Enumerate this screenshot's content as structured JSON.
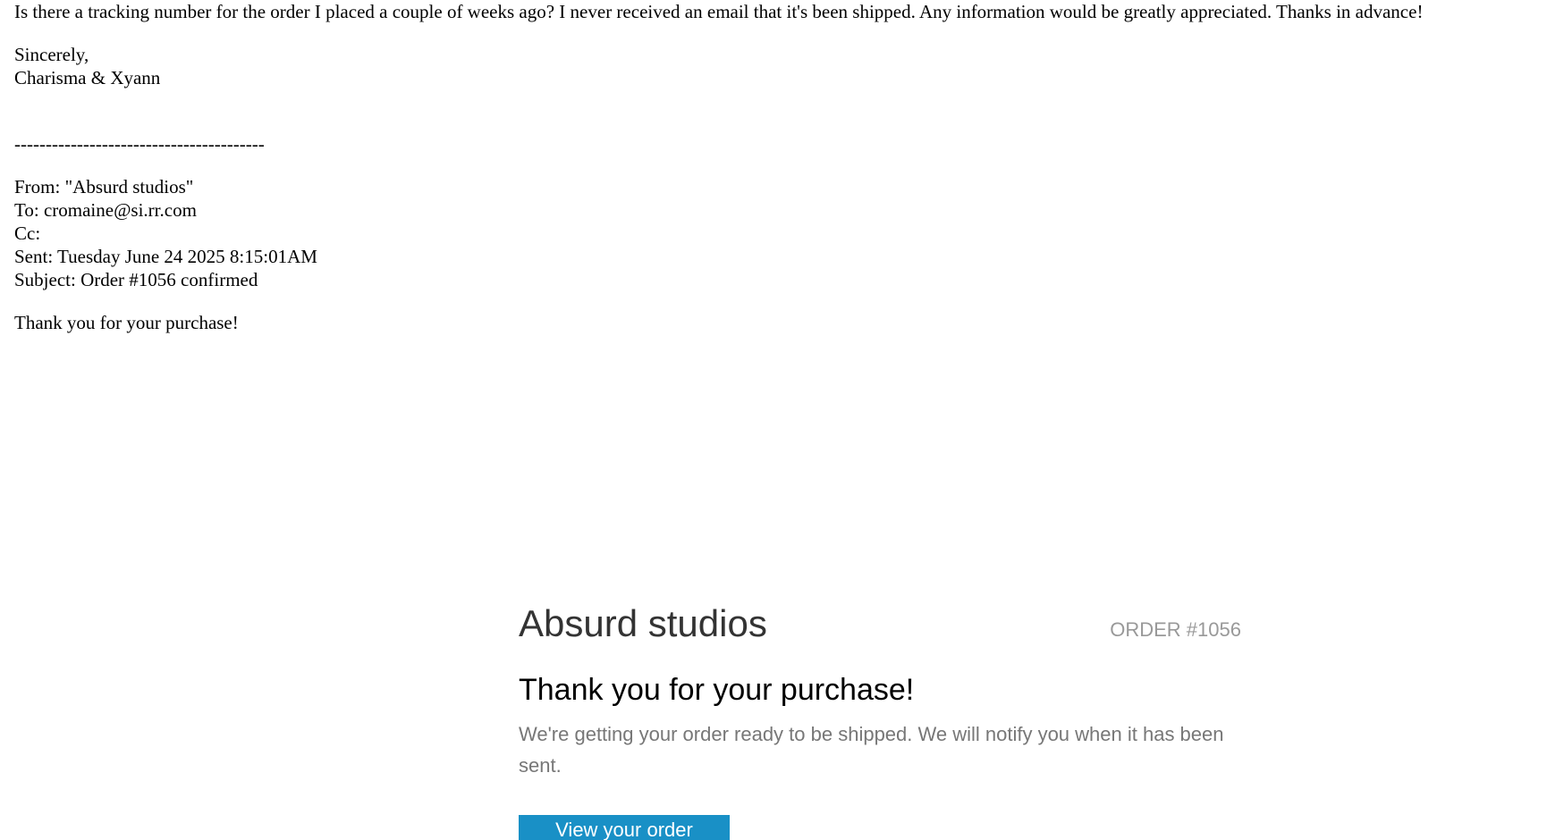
{
  "reply": {
    "body": "Is there a tracking number for the order I placed a couple of weeks ago? I never received an email that it's been shipped. Any information would be greatly appreciated. Thanks in advance!",
    "closing": "Sincerely,",
    "signature": "Charisma & Xyann"
  },
  "separator": "----------------------------------------",
  "quoted_header": {
    "from": "From: \"Absurd studios\"",
    "to": "To: cromaine@si.rr.com",
    "cc": "Cc:",
    "sent": "Sent: Tuesday June 24 2025 8:15:01AM",
    "subject": "Subject: Order #1056 confirmed"
  },
  "quoted_preview": "Thank you for your purchase!",
  "html_email": {
    "shop_name": "Absurd studios",
    "order_number": "ORDER #1056",
    "heading": "Thank you for your purchase!",
    "message": "We're getting your order ready to be shipped. We will notify you when it has been sent.",
    "button_label": "View your order",
    "button_color": "#1990c6"
  }
}
